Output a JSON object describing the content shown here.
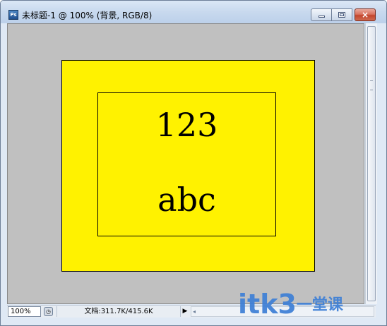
{
  "window": {
    "title": "未标题-1 @ 100% (背景, RGB/8)",
    "app_icon": "photoshop-document-icon",
    "buttons": {
      "minimize": "minimize-icon",
      "maximize": "maximize-icon",
      "close": "×"
    }
  },
  "canvas": {
    "background_color": "#c0c0c0",
    "outer_rect_color": "#fff200",
    "line1": "123",
    "line2": "abc"
  },
  "statusbar": {
    "zoom": "100%",
    "doc_info": "文档:311.7K/415.6K",
    "menu_arrow": "▶",
    "scroll_left_arrow": "◂"
  },
  "watermark": {
    "latin": "itk3",
    "chinese": "一堂课"
  },
  "colors": {
    "accent": "#3d7fd6",
    "close_button": "#c2452d"
  }
}
